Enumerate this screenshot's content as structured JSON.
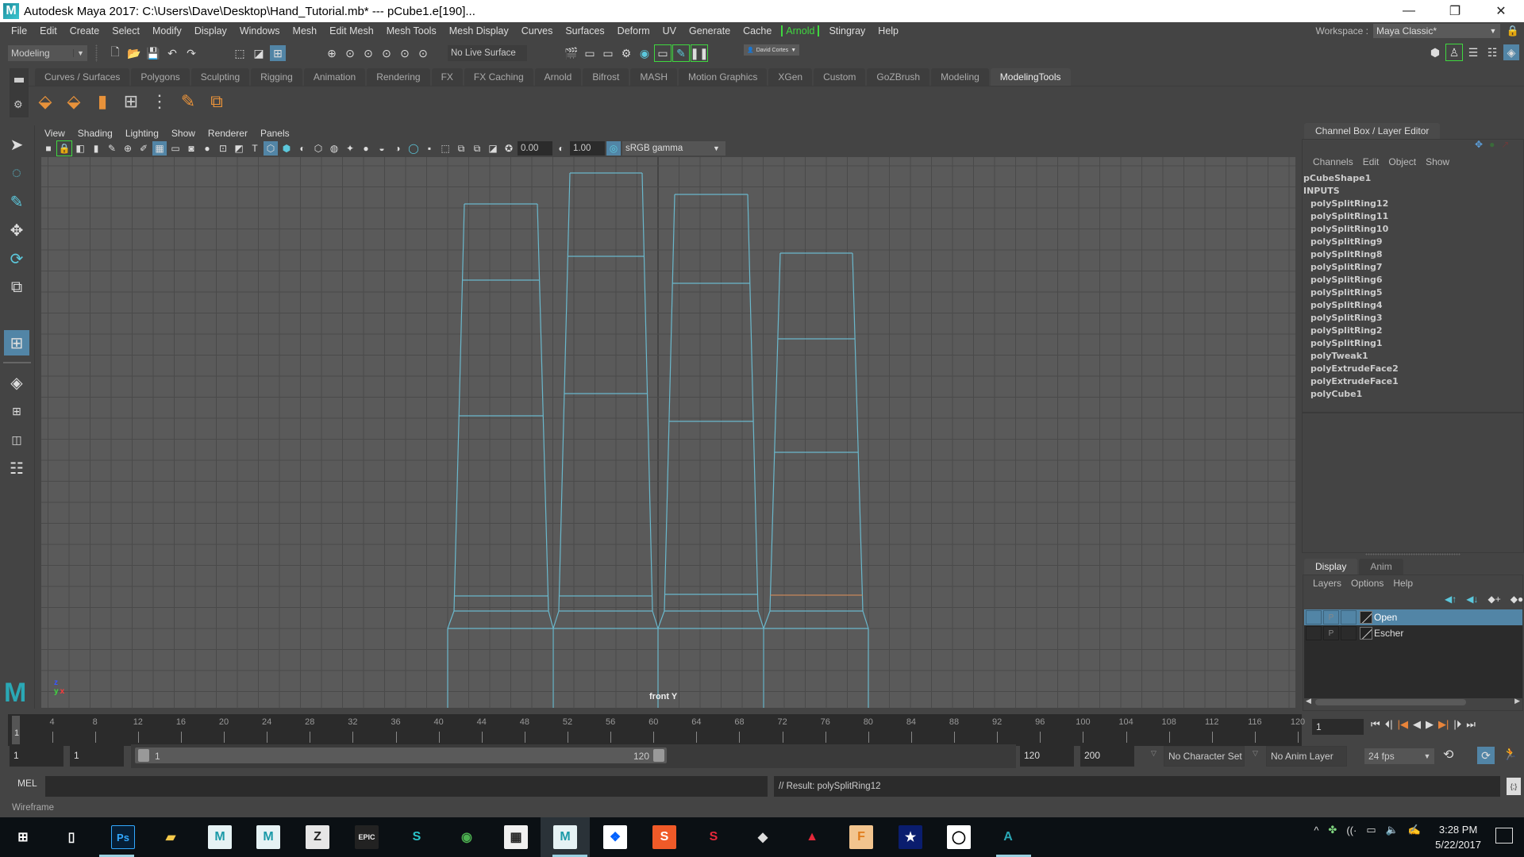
{
  "window": {
    "title": "Autodesk Maya 2017: C:\\Users\\Dave\\Desktop\\Hand_Tutorial.mb*   ---   pCube1.e[190]...",
    "app_icon": "maya-logo-icon",
    "controls": [
      "minimize-icon",
      "restore-icon",
      "close-icon"
    ],
    "minimize": "—",
    "restore": "❐",
    "close": "✕"
  },
  "menubar": {
    "items": [
      "File",
      "Edit",
      "Create",
      "Select",
      "Modify",
      "Display",
      "Windows",
      "Mesh",
      "Edit Mesh",
      "Mesh Tools",
      "Mesh Display",
      "Curves",
      "Surfaces",
      "Deform",
      "UV",
      "Generate",
      "Cache",
      "Arnold",
      "Stingray",
      "Help"
    ],
    "highlight": "Arnold",
    "highlight_color": "#3fd83f"
  },
  "workspace": {
    "label": "Workspace :",
    "value": "Maya Classic*"
  },
  "statusline": {
    "mode": "Modeling",
    "live_surface": "No Live Surface",
    "user": "David Cortes"
  },
  "shelf": {
    "tabs": [
      "Curves / Surfaces",
      "Polygons",
      "Sculpting",
      "Rigging",
      "Animation",
      "Rendering",
      "FX",
      "FX Caching",
      "Arnold",
      "Bifrost",
      "MASH",
      "Motion Graphics",
      "XGen",
      "Custom",
      "GoZBrush",
      "Modeling",
      "ModelingTools"
    ],
    "active_tab": "ModelingTools",
    "icons": [
      "extrude-icon",
      "bridge-icon",
      "bevel-box-icon",
      "insert-edge-loop-icon",
      "multi-cut-ring-icon",
      "multi-cut-knife-icon",
      "target-weld-icon"
    ]
  },
  "toolbox": {
    "tools": [
      "select-tool-icon",
      "lasso-tool-icon",
      "paint-select-icon",
      "move-tool-icon",
      "rotate-tool-icon",
      "scale-tool-icon"
    ],
    "layouts": [
      "single-perspective-layout-icon",
      "four-view-layout-icon",
      "persp-outliner-layout-icon",
      "outliner-layout-icon"
    ]
  },
  "viewport": {
    "menu": [
      "View",
      "Shading",
      "Lighting",
      "Show",
      "Renderer",
      "Panels"
    ],
    "exposure": "0.00",
    "gamma": "1.00",
    "color_space": "sRGB gamma",
    "camera_label": "front Y",
    "axis": {
      "z": "z",
      "y": "y",
      "x": "x"
    },
    "wire_color": "#6ab8cc",
    "selected_edge_color": "#c8875a"
  },
  "channel_box": {
    "tab": "Channel Box / Layer Editor",
    "menu": [
      "Channels",
      "Edit",
      "Object",
      "Show"
    ],
    "shape": "pCubeShape1",
    "inputs_header": "INPUTS",
    "inputs": [
      "polySplitRing12",
      "polySplitRing11",
      "polySplitRing10",
      "polySplitRing9",
      "polySplitRing8",
      "polySplitRing7",
      "polySplitRing6",
      "polySplitRing5",
      "polySplitRing4",
      "polySplitRing3",
      "polySplitRing2",
      "polySplitRing1",
      "polyTweak1",
      "polyExtrudeFace2",
      "polyExtrudeFace1",
      "polyCube1"
    ]
  },
  "layer_editor": {
    "tabs": [
      "Display",
      "Anim"
    ],
    "active_tab": "Display",
    "menu": [
      "Layers",
      "Options",
      "Help"
    ],
    "layers": [
      {
        "name": "Open",
        "p": "P",
        "selected": true
      },
      {
        "name": "Escher",
        "p": "P",
        "selected": false
      }
    ]
  },
  "timeline": {
    "ticks": [
      4,
      8,
      12,
      16,
      20,
      24,
      28,
      32,
      36,
      40,
      44,
      48,
      52,
      56,
      60,
      64,
      68,
      72,
      76,
      80,
      84,
      88,
      92,
      96,
      100,
      104,
      108,
      112,
      116,
      120
    ],
    "start": 1,
    "end": 120,
    "current_frame": "1",
    "current_frame_label": "1"
  },
  "range": {
    "anim_start": "1",
    "playback_start": "1",
    "range_start_label": "1",
    "range_end_label": "120",
    "playback_end": "120",
    "anim_end": "200",
    "character_set": "No Character Set",
    "anim_layer": "No Anim Layer",
    "fps": "24 fps"
  },
  "command_line": {
    "label": "MEL",
    "input": "",
    "result": "// Result: polySplitRing12"
  },
  "help_line": "Wireframe",
  "taskbar": {
    "apps": [
      {
        "name": "start",
        "glyph": "⊞",
        "bg": "transparent",
        "fg": "#ffffff"
      },
      {
        "name": "task-view",
        "glyph": "▯",
        "bg": "transparent",
        "fg": "#ffffff"
      },
      {
        "name": "photoshop",
        "glyph": "Ps",
        "bg": "#061e35",
        "fg": "#31a8ff"
      },
      {
        "name": "file-explorer",
        "glyph": "▰",
        "bg": "transparent",
        "fg": "#f5c94a"
      },
      {
        "name": "motionbuilder",
        "glyph": "M",
        "bg": "#e6f2f4",
        "fg": "#1c9aa8"
      },
      {
        "name": "mudbox",
        "glyph": "M",
        "bg": "#e6f2f4",
        "fg": "#1c9aa8"
      },
      {
        "name": "zbrush",
        "glyph": "Z",
        "bg": "#e6e6e6",
        "fg": "#222"
      },
      {
        "name": "epic-games",
        "glyph": "EPIC",
        "bg": "#222",
        "fg": "#eee"
      },
      {
        "name": "substance",
        "glyph": "S",
        "bg": "transparent",
        "fg": "#2ac3c8"
      },
      {
        "name": "chrome",
        "glyph": "◉",
        "bg": "transparent",
        "fg": "#4caf50"
      },
      {
        "name": "calculator",
        "glyph": "▦",
        "bg": "#f0f0f0",
        "fg": "#222"
      },
      {
        "name": "maya",
        "glyph": "M",
        "bg": "#e6f2f4",
        "fg": "#1c9aa8"
      },
      {
        "name": "dropbox",
        "glyph": "❖",
        "bg": "#ffffff",
        "fg": "#0061fe"
      },
      {
        "name": "substance-designer",
        "glyph": "S",
        "bg": "#f05a28",
        "fg": "#fff"
      },
      {
        "name": "substance-painter",
        "glyph": "S",
        "bg": "transparent",
        "fg": "#e5283a"
      },
      {
        "name": "unity",
        "glyph": "◆",
        "bg": "transparent",
        "fg": "#ddd"
      },
      {
        "name": "acrobat",
        "glyph": "▲",
        "bg": "transparent",
        "fg": "#e5283a"
      },
      {
        "name": "fusion-360",
        "glyph": "F",
        "bg": "#f2c48e",
        "fg": "#e07b1a"
      },
      {
        "name": "cinema-app",
        "glyph": "★",
        "bg": "#0a1d6e",
        "fg": "#fff"
      },
      {
        "name": "oculus",
        "glyph": "◯",
        "bg": "#ffffff",
        "fg": "#000"
      },
      {
        "name": "autodesk-app",
        "glyph": "A",
        "bg": "transparent",
        "fg": "#2aa8b5"
      }
    ],
    "active_app": "maya",
    "tray": [
      "chevron-up-icon",
      "dropbox-tray-icon",
      "wifi-icon",
      "battery-icon",
      "volume-icon",
      "pen-icon"
    ],
    "time": "3:28 PM",
    "date": "5/22/2017"
  }
}
